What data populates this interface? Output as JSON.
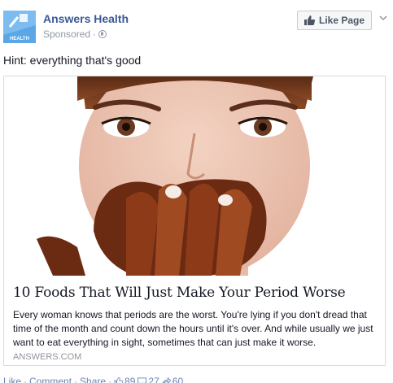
{
  "post": {
    "page_name": "Answers Health",
    "sponsored": "Sponsored",
    "meta_sep": "·",
    "avatar_label": "HEALTH",
    "like_page_label": "Like Page",
    "text": "Hint: everything that's good"
  },
  "link": {
    "title": "10 Foods That Will Just Make Your Period Worse",
    "description": "Every woman knows that periods are the worst. You're lying if you don't dread that time of the month and count down the hours until it's over. And while usually we just want to eat everything in sight, sometimes that can just make it worse.",
    "domain": "ANSWERS.COM"
  },
  "actions": {
    "like": "Like",
    "comment": "Comment",
    "share": "Share",
    "sep": "·",
    "likes_count": "89",
    "comments_count": "27",
    "shares_count": "60"
  },
  "colors": {
    "brand_blue": "#3b5998",
    "link_blue": "#6d84b4",
    "muted_gray": "#9197a3"
  },
  "icons": [
    "health-logo-icon",
    "globe-icon",
    "thumbs-up-icon",
    "chevron-down-icon",
    "like-count-icon",
    "comment-count-icon",
    "share-count-icon"
  ]
}
